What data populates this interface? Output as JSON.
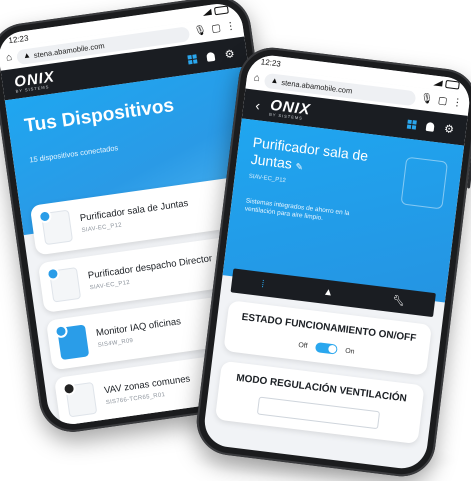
{
  "left_phone": {
    "status": {
      "time": "12:23"
    },
    "browser": {
      "url": "stena.abamobile.com"
    },
    "app": {
      "logo": "ONIX",
      "logo_sub": "BY SISTEMS"
    },
    "hero": {
      "title": "Tus Dispositivos",
      "subtitle": "15 dispositivos conectados"
    },
    "devices": [
      {
        "name": "Purificador sala de Juntas",
        "code": "SIAV-EC_P12",
        "status": "online"
      },
      {
        "name": "Purificador despacho Director",
        "code": "SIAV-EC_P12",
        "status": "online"
      },
      {
        "name": "Monitor IAQ oficinas",
        "code": "SIS4W_R09",
        "status": "online"
      },
      {
        "name": "VAV zonas comunes",
        "code": "SIS766-TCR65_R01",
        "status": "online"
      }
    ],
    "colors": {
      "accent": "#2aa7ee",
      "appbar": "#1a1d22",
      "online": "#1aa84a"
    }
  },
  "right_phone": {
    "status": {
      "time": "12:23"
    },
    "browser": {
      "url": "stena.abamobile.com"
    },
    "app": {
      "logo": "ONIX",
      "logo_sub": "BY SISTEMS"
    },
    "device": {
      "title": "Purificador sala de Juntas",
      "code": "SIAV-EC_P12",
      "description": "Sistemas integrados de ahorro en la ventilación para aire limpio."
    },
    "tabs": [
      "stats-icon",
      "alert-icon",
      "wrench-icon"
    ],
    "cards": [
      {
        "title": "ESTADO FUNCIONAMIENTO ON/OFF",
        "off_label": "Off",
        "on_label": "On",
        "state": "on"
      },
      {
        "title": "MODO REGULACIÓN VENTILACIÓN"
      }
    ]
  }
}
